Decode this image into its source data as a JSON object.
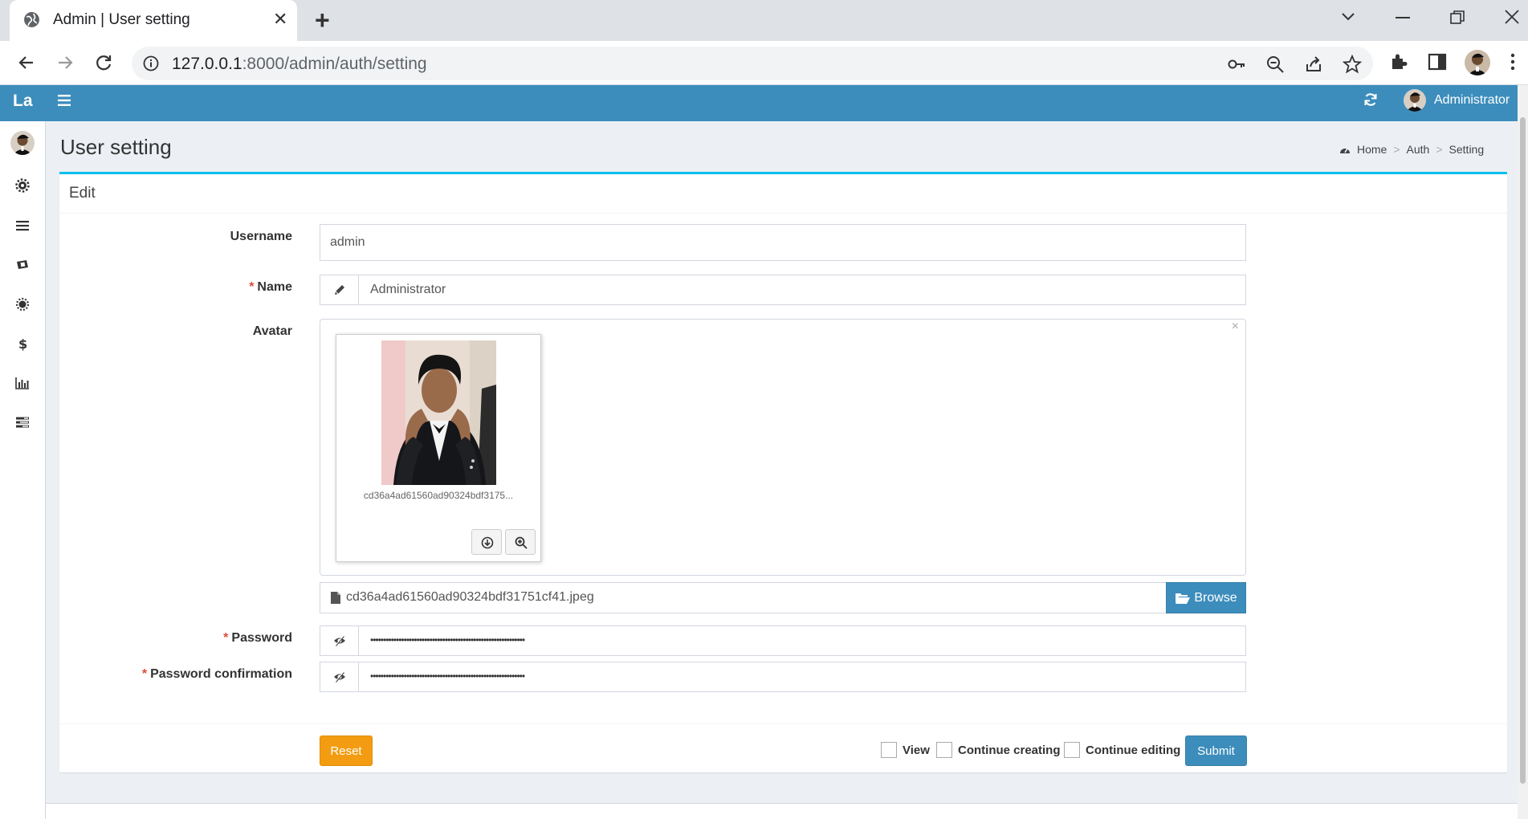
{
  "browser": {
    "tab_title": "Admin | User setting",
    "url_host": "127.0.0.1",
    "url_rest": ":8000/admin/auth/setting"
  },
  "header": {
    "logo": "La",
    "user_name": "Administrator"
  },
  "page": {
    "title": "User setting",
    "breadcrumb": [
      "Home",
      "Auth",
      "Setting"
    ]
  },
  "sidebar": {
    "icons": [
      "cog-icon",
      "bars-icon",
      "ticket-icon",
      "gear-icon",
      "dollar-icon",
      "bar-chart-icon",
      "tasks-icon"
    ]
  },
  "form": {
    "box_title": "Edit",
    "username_label": "Username",
    "username_value": "admin",
    "name_label": "Name",
    "name_value": "Administrator",
    "avatar_label": "Avatar",
    "avatar_caption": "cd36a4ad61560ad90324bdf3175...",
    "avatar_filename": "cd36a4ad61560ad90324bdf31751cf41.jpeg",
    "browse_label": "Browse",
    "password_label": "Password",
    "password_value": "••••••••••••••••••••••••••••••••••••••••••••••••••••••••••••",
    "password_confirm_label": "Password confirmation",
    "password_confirm_value": "••••••••••••••••••••••••••••••••••••••••••••••••••••••••••••",
    "required_mark": "*"
  },
  "footer": {
    "reset_label": "Reset",
    "view_label": "View",
    "continue_creating_label": "Continue creating",
    "continue_editing_label": "Continue editing",
    "submit_label": "Submit"
  },
  "colors": {
    "header": "#3c8dbc",
    "box_accent": "#00c0ef",
    "reset": "#f39c12",
    "required": "#dd4b39"
  }
}
